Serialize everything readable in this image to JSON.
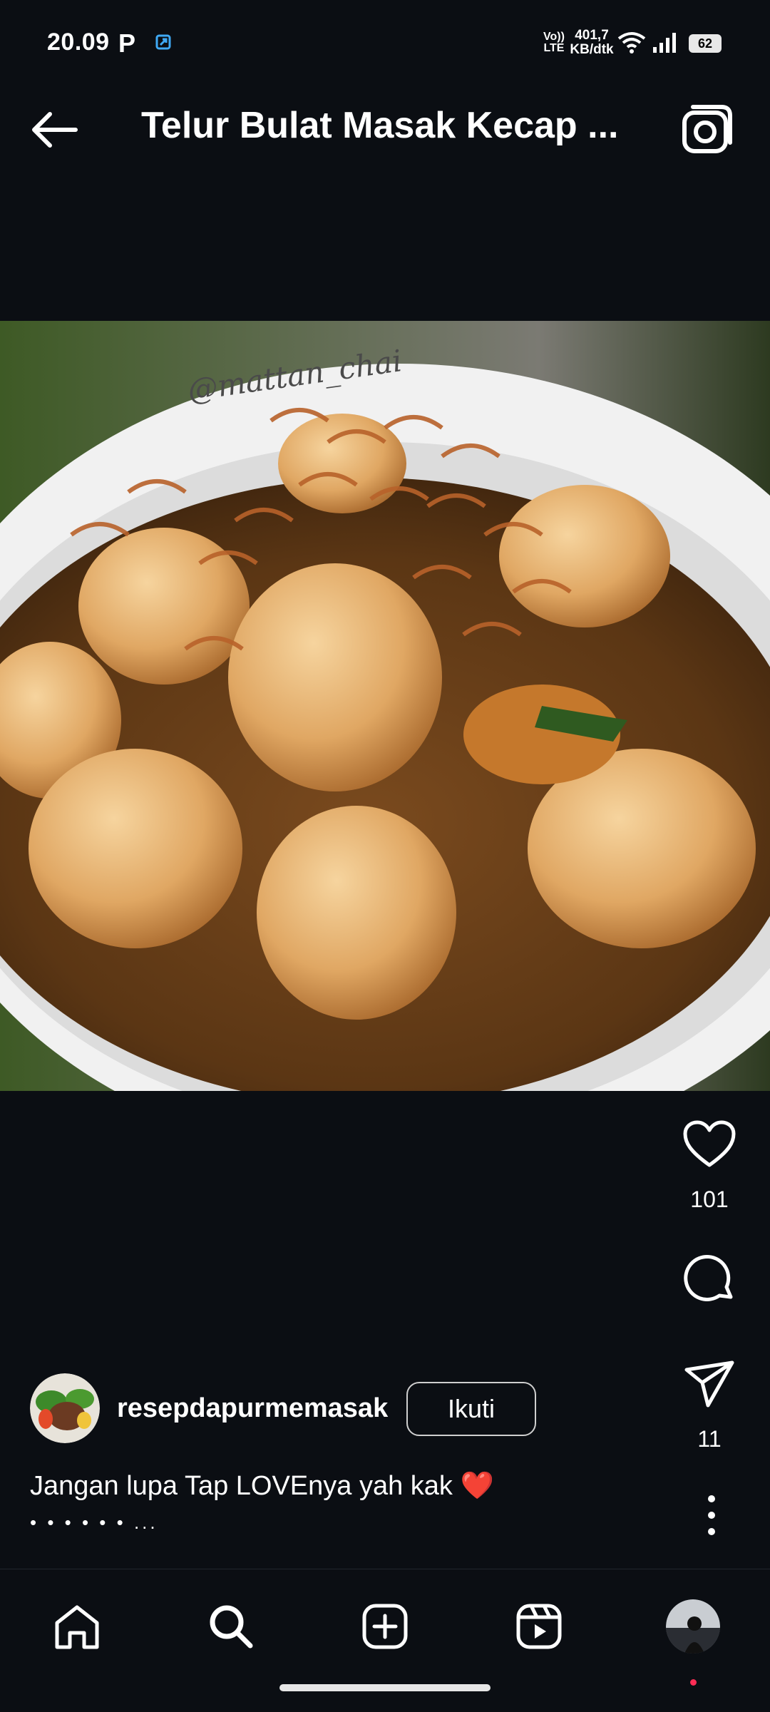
{
  "status_bar": {
    "time": "20.09",
    "carrier_letter": "P",
    "volte_line1": "Vo))",
    "volte_line2": "LTE",
    "speed_line1": "401,7",
    "speed_line2": "KB/dtk",
    "battery": "62"
  },
  "header": {
    "title": "Telur Bulat Masak Kecap ..."
  },
  "photo": {
    "watermark": "@mattan_chai"
  },
  "actions": {
    "likes": "101",
    "shares": "11"
  },
  "owner": {
    "username": "resepdapurmemasak",
    "follow_label": "Ikuti"
  },
  "caption": {
    "text": "Jangan lupa Tap LOVEnya yah kak ❤️",
    "dots": "• • • • • • ..."
  },
  "colors": {
    "background": "#0b0e13",
    "text": "#ffffff",
    "notification_dot": "#ff2d55"
  }
}
